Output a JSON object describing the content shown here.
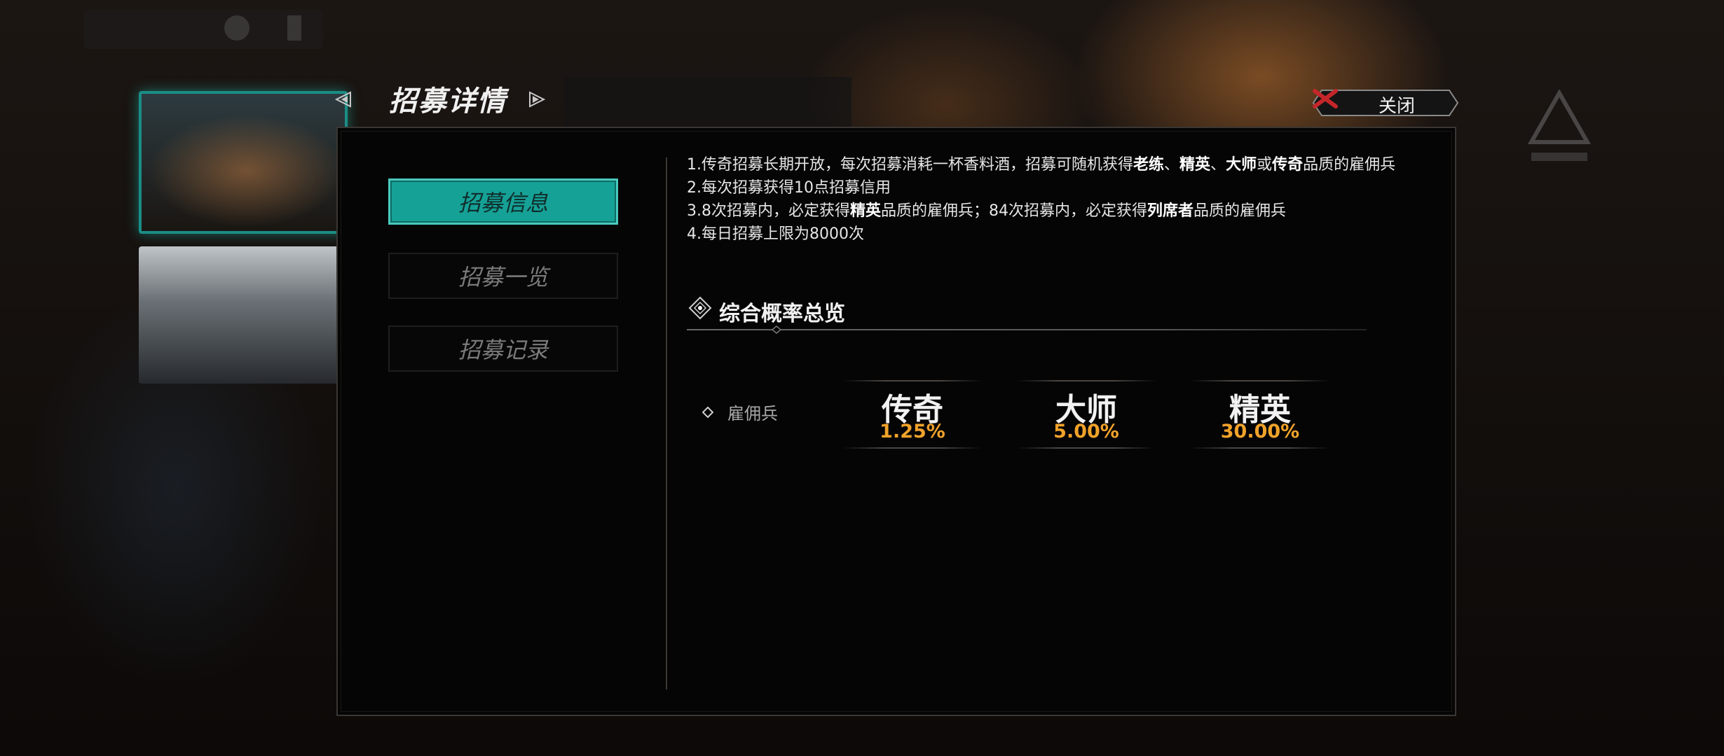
{
  "header": {
    "title": "招募详情",
    "close_label": "关闭"
  },
  "tabs": [
    {
      "label": "招募信息",
      "active": true
    },
    {
      "label": "招募一览",
      "active": false
    },
    {
      "label": "招募记录",
      "active": false
    }
  ],
  "info": {
    "rule1": {
      "a": "1.传奇招募长期开放，每次招募消耗一杯香料酒，招募可随机获得",
      "b": "老练",
      "c": "、",
      "d": "精英",
      "e": "、",
      "f": "大师",
      "g": "或",
      "h": "传奇",
      "i": "品质的雇佣兵"
    },
    "rule2": "2.每次招募获得10点招募信用",
    "rule3": {
      "a": "3.8次招募内，必定获得",
      "b": "精英",
      "c": "品质的雇佣兵；84次招募内，必定获得",
      "d": "列席者",
      "e": "品质的雇佣兵"
    },
    "rule4": "4.每日招募上限为8000次"
  },
  "probability": {
    "section_title": "综合概率总览",
    "row_label": "雇佣兵",
    "rates": [
      {
        "name": "传奇",
        "value": "1.25%"
      },
      {
        "name": "大师",
        "value": "5.00%"
      },
      {
        "name": "精英",
        "value": "30.00%"
      }
    ]
  },
  "colors": {
    "accent_teal": "#16a196",
    "rate_orange": "#f0a22a",
    "close_x_red": "#c4262a"
  },
  "icons": {
    "nav_prev": "triangle-left-icon",
    "nav_next": "triangle-right-icon",
    "close": "x-mark-icon",
    "section": "diamond-icon",
    "bullet": "diamond-outline-icon"
  }
}
